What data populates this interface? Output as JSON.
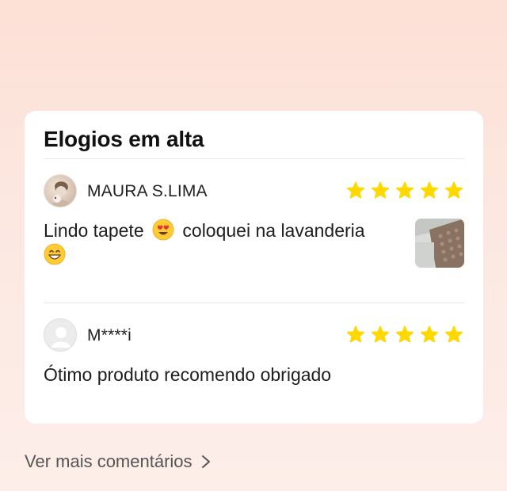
{
  "section": {
    "title": "Elogios em alta"
  },
  "reviews": [
    {
      "author": "MAURA S.LIMA",
      "rating": 5,
      "text_part1": "Lindo tapete",
      "text_part2": "coloquei na lavanderia",
      "emojis": [
        "heart-eyes-emoji",
        "grinning-emoji"
      ],
      "has_photo": true,
      "avatar": "user-photo-avatar"
    },
    {
      "author": "M****i",
      "rating": 5,
      "text": "Ótimo produto recomendo obrigado",
      "has_photo": false,
      "avatar": "default-user-avatar"
    }
  ],
  "see_more": {
    "label": "Ver mais comentários",
    "icon": "chevron-right-icon"
  },
  "colors": {
    "star": "#ffd800",
    "background_top": "#fde0d6",
    "card": "#ffffff"
  }
}
